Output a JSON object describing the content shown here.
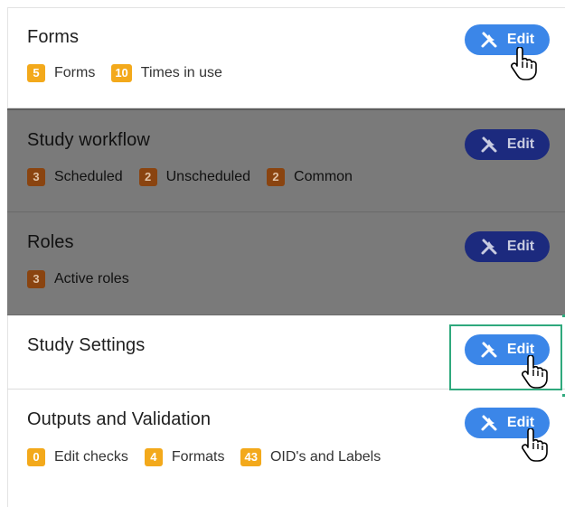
{
  "sections": [
    {
      "title": "Forms",
      "badges": [
        {
          "count": "5",
          "label": "Forms"
        },
        {
          "count": "10",
          "label": "Times in use"
        }
      ],
      "edit_label": "Edit"
    },
    {
      "title": "Study workflow",
      "badges": [
        {
          "count": "3",
          "label": "Scheduled"
        },
        {
          "count": "2",
          "label": "Unscheduled"
        },
        {
          "count": "2",
          "label": "Common"
        }
      ],
      "edit_label": "Edit"
    },
    {
      "title": "Roles",
      "badges": [
        {
          "count": "3",
          "label": "Active roles"
        }
      ],
      "edit_label": "Edit"
    },
    {
      "title": "Study Settings",
      "badges": [],
      "edit_label": "Edit"
    },
    {
      "title": "Outputs and Validation",
      "badges": [
        {
          "count": "0",
          "label": "Edit checks"
        },
        {
          "count": "4",
          "label": "Formats"
        },
        {
          "count": "43",
          "label": "OID's and Labels"
        }
      ],
      "edit_label": "Edit"
    }
  ],
  "icons": {
    "edit": "tools-icon",
    "cursor": "hand-pointer-icon"
  },
  "colors": {
    "edit_button": "#3b86e8",
    "edit_button_dimmed": "#1c2a7e",
    "badge": "#f3a91b",
    "badge_dimmed": "#8a4410",
    "overlay": "#7a7a7a",
    "focus_outline": "#2fa97d"
  }
}
